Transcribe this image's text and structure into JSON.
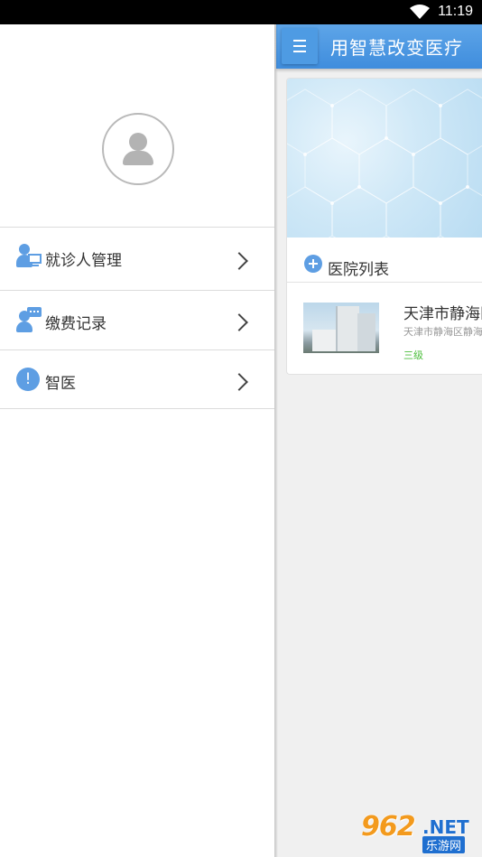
{
  "status_bar": {
    "time": "11:19"
  },
  "appbar": {
    "title": "用智慧改变医疗"
  },
  "drawer": {
    "items": [
      {
        "label": "就诊人管理",
        "icon": "patient-monitor-icon"
      },
      {
        "label": "缴费记录",
        "icon": "payment-chat-icon"
      },
      {
        "label": "智医",
        "icon": "exclamation-icon",
        "icon_glyph": "!"
      }
    ]
  },
  "hospital_list": {
    "title": "医院列表",
    "hospitals": [
      {
        "name": "天津市静海区",
        "address": "天津市静海区静海",
        "level": "三级"
      }
    ]
  },
  "watermark": {
    "number": "962",
    "suffix": ".NET",
    "chinese": "乐游网"
  },
  "colors": {
    "accent": "#4a97e0",
    "level_green": "#4cbe3c",
    "watermark_orange": "#f39a1d",
    "watermark_blue": "#1f6fd0"
  }
}
